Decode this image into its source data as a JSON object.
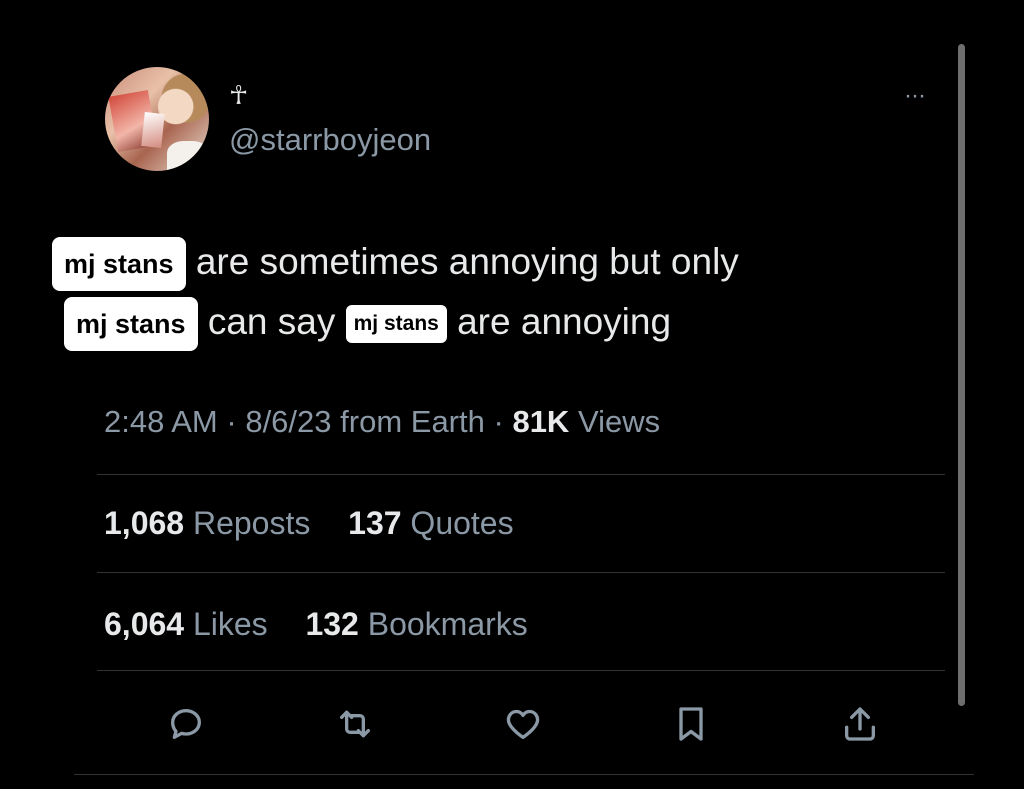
{
  "author": {
    "display_name": "☥",
    "handle": "@starrboyjeon"
  },
  "menu": {
    "more_label": "···"
  },
  "tweet": {
    "tag_text": "mj stans",
    "line1_text": "are sometimes annoying but only",
    "line2_mid_text": "can say",
    "line2_end_text": "are annoying"
  },
  "meta": {
    "time": "2:48 AM",
    "date": "8/6/23",
    "source": "from Earth",
    "views_count": "81K",
    "views_label": "Views"
  },
  "stats": {
    "reposts_count": "1,068",
    "reposts_label": "Reposts",
    "quotes_count": "137",
    "quotes_label": "Quotes",
    "likes_count": "6,064",
    "likes_label": "Likes",
    "bookmarks_count": "132",
    "bookmarks_label": "Bookmarks"
  },
  "actions": [
    "reply-icon",
    "repost-icon",
    "like-icon",
    "bookmark-icon",
    "share-icon"
  ],
  "colors": {
    "background": "#000000",
    "text_primary": "#e7e9ea",
    "text_secondary": "#8b98a5",
    "divider": "#2f3336",
    "tag_background": "#ffffff"
  }
}
